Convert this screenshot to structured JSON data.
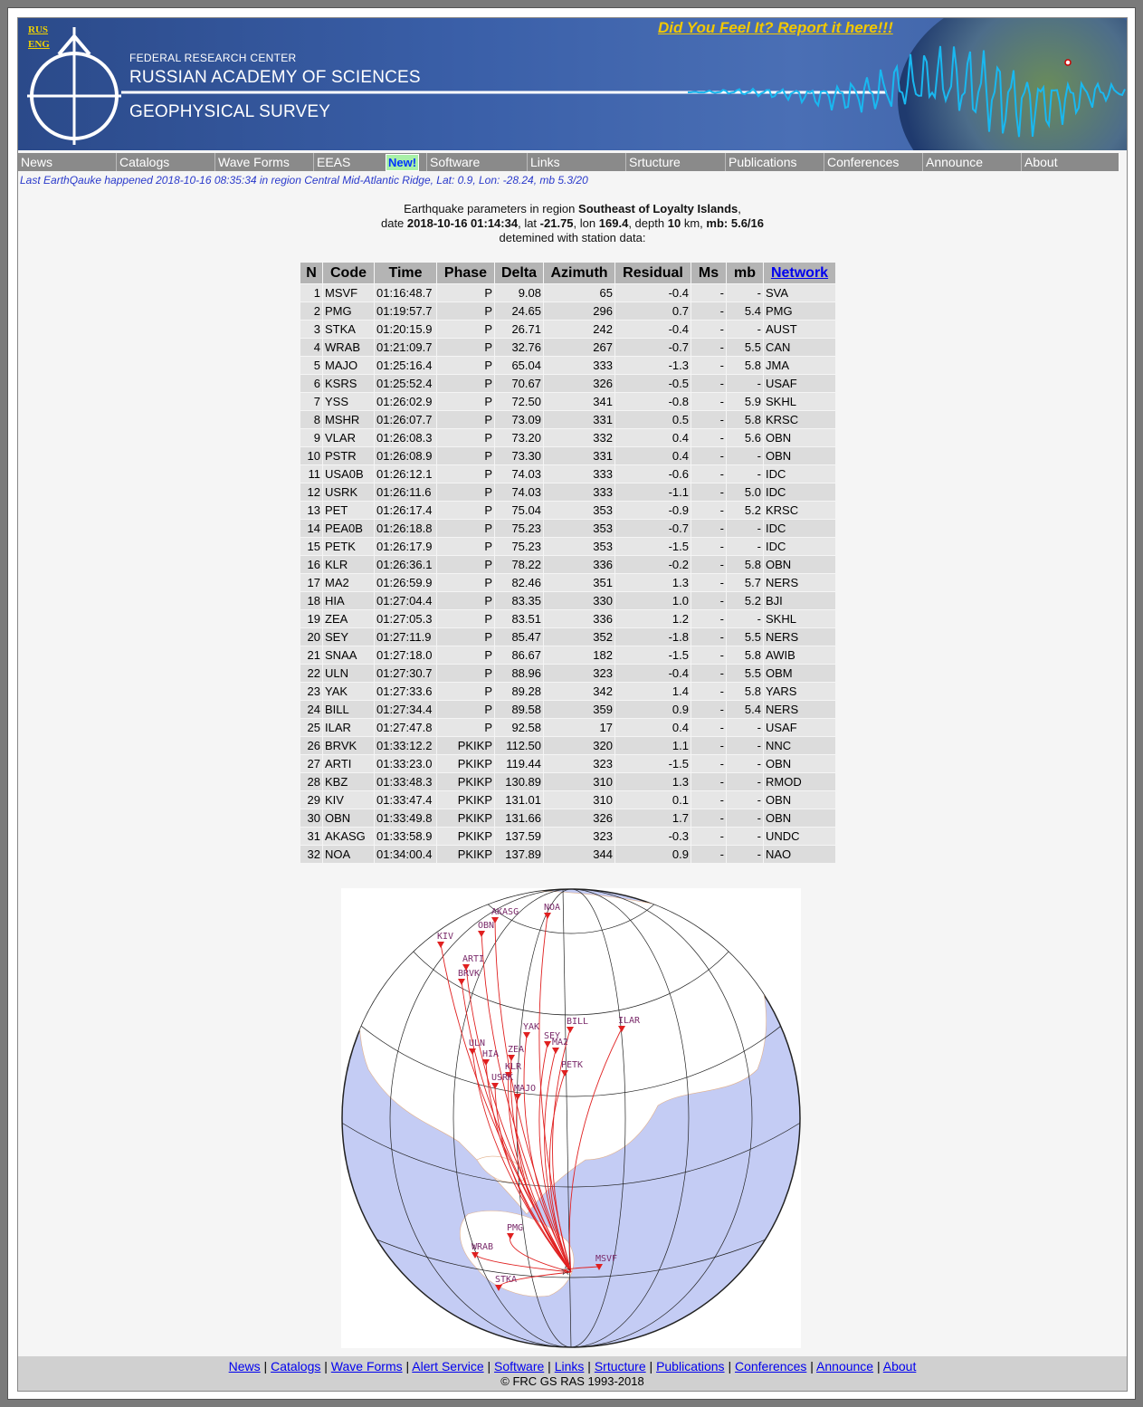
{
  "header": {
    "lang_rus": "RUS",
    "lang_eng": "ENG",
    "org_line1": "FEDERAL RESEARCH CENTER",
    "org_line2": "RUSSIAN ACADEMY OF SCIENCES",
    "org_line3": "GEOPHYSICAL SURVEY",
    "report_link": "Did You Feel It? Report it here!!!"
  },
  "nav": {
    "items": [
      "News",
      "Catalogs",
      "Wave Forms",
      "EEAS",
      "Software",
      "Links",
      "Srtucture",
      "Publications",
      "Conferences",
      "Announce",
      "About"
    ],
    "new_badge": "New!"
  },
  "last_quake": "Last EarthQauke happened 2018-10-16 08:35:34 in region Central Mid-Atlantic Ridge, Lat: 0.9, Lon: -28.24, mb 5.3/20",
  "event": {
    "intro": "Earthquake parameters in region",
    "region": "Southeast of Loyalty Islands",
    "date_label": "date",
    "datetime": "2018-10-16 01:14:34",
    "lat_label": "lat",
    "lat": "-21.75",
    "lon_label": "lon",
    "lon": "169.4",
    "depth_label": "depth",
    "depth": "10",
    "depth_unit": "km",
    "mb_label": "mb:",
    "mb": "5.6/16",
    "determined": "detemined with station data:"
  },
  "table": {
    "headers": [
      "N",
      "Code",
      "Time",
      "Phase",
      "Delta",
      "Azimuth",
      "Residual",
      "Ms",
      "mb",
      "Network"
    ],
    "rows": [
      [
        "1",
        "MSVF",
        "01:16:48.7",
        "P",
        "9.08",
        "65",
        "-0.4",
        "-",
        "-",
        "SVA"
      ],
      [
        "2",
        "PMG",
        "01:19:57.7",
        "P",
        "24.65",
        "296",
        "0.7",
        "-",
        "5.4",
        "PMG"
      ],
      [
        "3",
        "STKA",
        "01:20:15.9",
        "P",
        "26.71",
        "242",
        "-0.4",
        "-",
        "-",
        "AUST"
      ],
      [
        "4",
        "WRAB",
        "01:21:09.7",
        "P",
        "32.76",
        "267",
        "-0.7",
        "-",
        "5.5",
        "CAN"
      ],
      [
        "5",
        "MAJO",
        "01:25:16.4",
        "P",
        "65.04",
        "333",
        "-1.3",
        "-",
        "5.8",
        "JMA"
      ],
      [
        "6",
        "KSRS",
        "01:25:52.4",
        "P",
        "70.67",
        "326",
        "-0.5",
        "-",
        "-",
        "USAF"
      ],
      [
        "7",
        "YSS",
        "01:26:02.9",
        "P",
        "72.50",
        "341",
        "-0.8",
        "-",
        "5.9",
        "SKHL"
      ],
      [
        "8",
        "MSHR",
        "01:26:07.7",
        "P",
        "73.09",
        "331",
        "0.5",
        "-",
        "5.8",
        "KRSC"
      ],
      [
        "9",
        "VLAR",
        "01:26:08.3",
        "P",
        "73.20",
        "332",
        "0.4",
        "-",
        "5.6",
        "OBN"
      ],
      [
        "10",
        "PSTR",
        "01:26:08.9",
        "P",
        "73.30",
        "331",
        "0.4",
        "-",
        "-",
        "OBN"
      ],
      [
        "11",
        "USA0B",
        "01:26:12.1",
        "P",
        "74.03",
        "333",
        "-0.6",
        "-",
        "-",
        "IDC"
      ],
      [
        "12",
        "USRK",
        "01:26:11.6",
        "P",
        "74.03",
        "333",
        "-1.1",
        "-",
        "5.0",
        "IDC"
      ],
      [
        "13",
        "PET",
        "01:26:17.4",
        "P",
        "75.04",
        "353",
        "-0.9",
        "-",
        "5.2",
        "KRSC"
      ],
      [
        "14",
        "PEA0B",
        "01:26:18.8",
        "P",
        "75.23",
        "353",
        "-0.7",
        "-",
        "-",
        "IDC"
      ],
      [
        "15",
        "PETK",
        "01:26:17.9",
        "P",
        "75.23",
        "353",
        "-1.5",
        "-",
        "-",
        "IDC"
      ],
      [
        "16",
        "KLR",
        "01:26:36.1",
        "P",
        "78.22",
        "336",
        "-0.2",
        "-",
        "5.8",
        "OBN"
      ],
      [
        "17",
        "MA2",
        "01:26:59.9",
        "P",
        "82.46",
        "351",
        "1.3",
        "-",
        "5.7",
        "NERS"
      ],
      [
        "18",
        "HIA",
        "01:27:04.4",
        "P",
        "83.35",
        "330",
        "1.0",
        "-",
        "5.2",
        "BJI"
      ],
      [
        "19",
        "ZEA",
        "01:27:05.3",
        "P",
        "83.51",
        "336",
        "1.2",
        "-",
        "-",
        "SKHL"
      ],
      [
        "20",
        "SEY",
        "01:27:11.9",
        "P",
        "85.47",
        "352",
        "-1.8",
        "-",
        "5.5",
        "NERS"
      ],
      [
        "21",
        "SNAA",
        "01:27:18.0",
        "P",
        "86.67",
        "182",
        "-1.5",
        "-",
        "5.8",
        "AWIB"
      ],
      [
        "22",
        "ULN",
        "01:27:30.7",
        "P",
        "88.96",
        "323",
        "-0.4",
        "-",
        "5.5",
        "OBM"
      ],
      [
        "23",
        "YAK",
        "01:27:33.6",
        "P",
        "89.28",
        "342",
        "1.4",
        "-",
        "5.8",
        "YARS"
      ],
      [
        "24",
        "BILL",
        "01:27:34.4",
        "P",
        "89.58",
        "359",
        "0.9",
        "-",
        "5.4",
        "NERS"
      ],
      [
        "25",
        "ILAR",
        "01:27:47.8",
        "P",
        "92.58",
        "17",
        "0.4",
        "-",
        "-",
        "USAF"
      ],
      [
        "26",
        "BRVK",
        "01:33:12.2",
        "PKIKP",
        "112.50",
        "320",
        "1.1",
        "-",
        "-",
        "NNC"
      ],
      [
        "27",
        "ARTI",
        "01:33:23.0",
        "PKIKP",
        "119.44",
        "323",
        "-1.5",
        "-",
        "-",
        "OBN"
      ],
      [
        "28",
        "KBZ",
        "01:33:48.3",
        "PKIKP",
        "130.89",
        "310",
        "1.3",
        "-",
        "-",
        "RMOD"
      ],
      [
        "29",
        "KIV",
        "01:33:47.4",
        "PKIKP",
        "131.01",
        "310",
        "0.1",
        "-",
        "-",
        "OBN"
      ],
      [
        "30",
        "OBN",
        "01:33:49.8",
        "PKIKP",
        "131.66",
        "326",
        "1.7",
        "-",
        "-",
        "OBN"
      ],
      [
        "31",
        "AKASG",
        "01:33:58.9",
        "PKIKP",
        "137.59",
        "323",
        "-0.3",
        "-",
        "-",
        "UNDC"
      ],
      [
        "32",
        "NOA",
        "01:34:00.4",
        "PKIKP",
        "137.89",
        "344",
        "0.9",
        "-",
        "-",
        "NAO"
      ]
    ]
  },
  "map": {
    "labels": [
      "MSVF",
      "PMG",
      "WRAB",
      "STKA",
      "ILAR",
      "BILL",
      "YAK",
      "SEY",
      "MA2",
      "PETK",
      "ULN",
      "HIA",
      "ZEA",
      "KLR",
      "USRK",
      "MAJO",
      "BRVK",
      "ARTI",
      "OBN",
      "AKASG",
      "NOA",
      "KIV"
    ]
  },
  "footer": {
    "links": [
      "News",
      "Catalogs",
      "Wave Forms",
      "Alert Service",
      "Software",
      "Links",
      "Srtucture",
      "Publications",
      "Conferences",
      "Announce",
      "About"
    ],
    "copyright": "© FRC GS RAS 1993-2018"
  },
  "colors": {
    "banner": "#3a5fa8",
    "report": "#f2c800",
    "nav": "#8a8a8a",
    "path": "#e02020",
    "ocean": "#c7cff5"
  }
}
